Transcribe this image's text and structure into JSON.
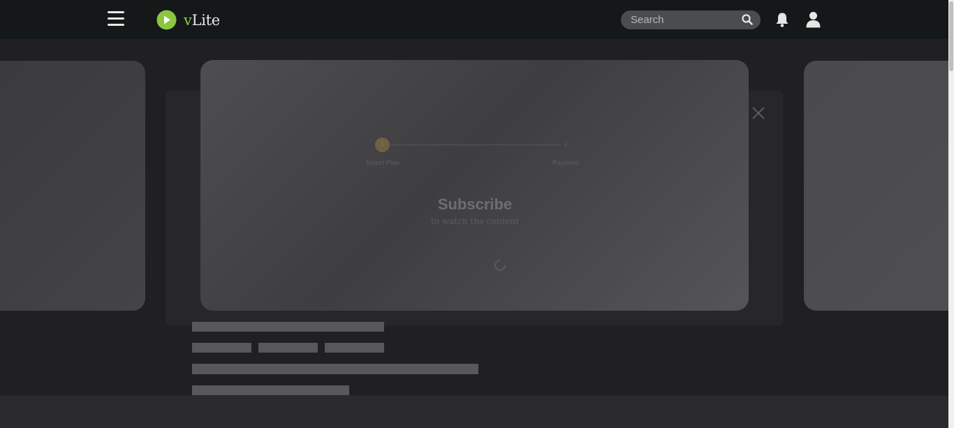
{
  "app": {
    "brand_prefix": "v",
    "brand_suffix": "Lite",
    "brand_color": "#8cc63f"
  },
  "header": {
    "search_placeholder": "Search",
    "icons": [
      "menu-icon",
      "search-icon",
      "bell-icon",
      "user-icon"
    ]
  },
  "modal": {
    "steps": [
      {
        "number": "1",
        "label": "Select Plan"
      },
      {
        "number": "2",
        "label": "Payment"
      }
    ],
    "title": "Subscribe",
    "subtitle": "to watch the content",
    "loading": true
  },
  "colors": {
    "header_bg": "#141819",
    "page_bg": "#202022",
    "step_active": "#6f6043"
  }
}
